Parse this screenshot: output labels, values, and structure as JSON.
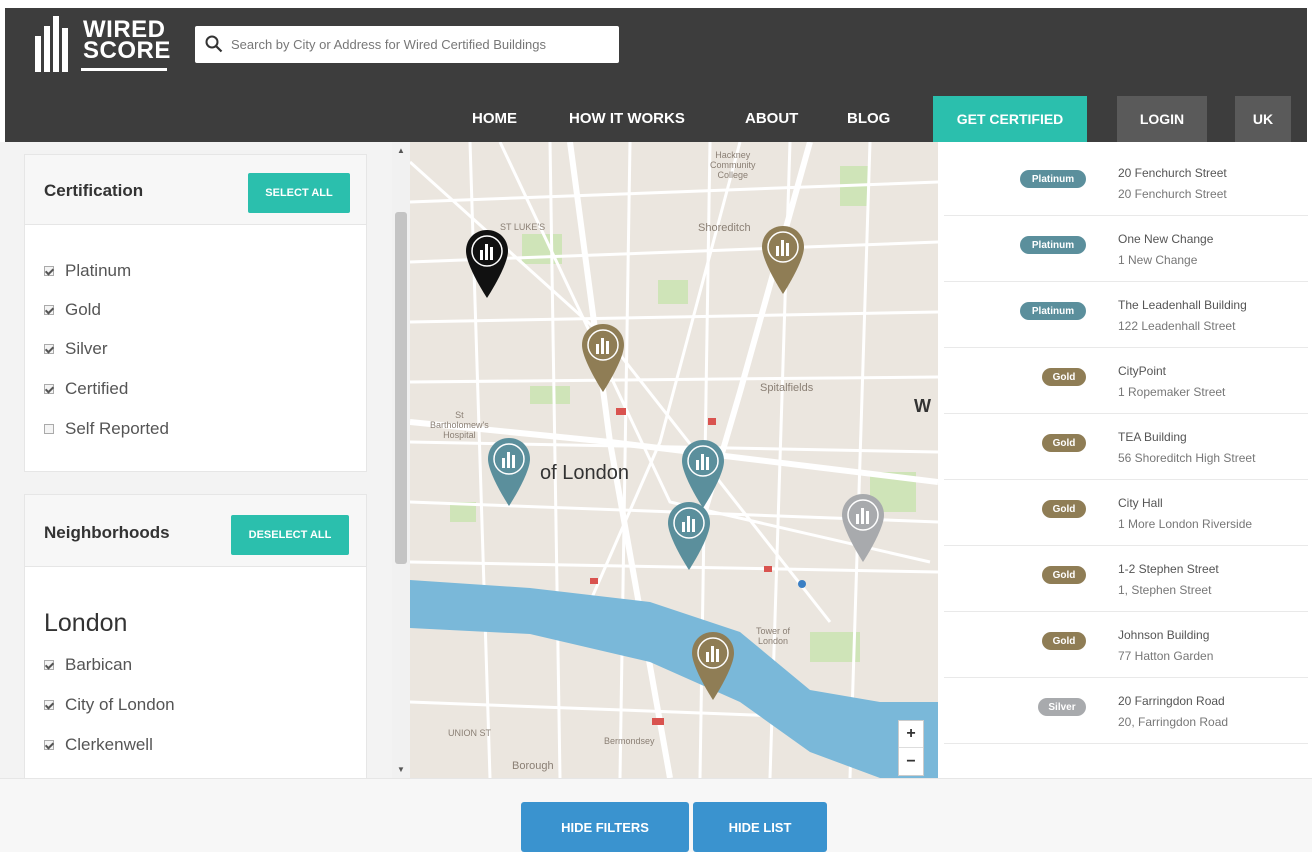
{
  "brand": {
    "line1": "WIRED",
    "line2": "SCORE"
  },
  "search": {
    "placeholder": "Search by City or Address for Wired Certified Buildings"
  },
  "nav": {
    "links": [
      "HOME",
      "HOW IT WORKS",
      "ABOUT",
      "BLOG"
    ],
    "get_certified": "GET CERTIFIED",
    "login": "LOGIN",
    "region": "UK"
  },
  "filters": {
    "certification": {
      "title": "Certification",
      "button": "SELECT ALL",
      "options": [
        {
          "label": "Platinum",
          "checked": true
        },
        {
          "label": "Gold",
          "checked": true
        },
        {
          "label": "Silver",
          "checked": true
        },
        {
          "label": "Certified",
          "checked": true
        },
        {
          "label": "Self Reported",
          "checked": false
        }
      ]
    },
    "neighborhoods": {
      "title": "Neighborhoods",
      "button": "DESELECT ALL",
      "city": "London",
      "options": [
        {
          "label": "Barbican",
          "checked": true
        },
        {
          "label": "City of London",
          "checked": true
        },
        {
          "label": "Clerkenwell",
          "checked": true
        }
      ]
    }
  },
  "map": {
    "labels": {
      "hackney": "Hackney\nCommunity\nCollege",
      "shoreditch": "Shoreditch",
      "st_lukes": "ST LUKE'S",
      "spitalfields": "Spitalfields",
      "barts": "St\nBartholomew's\nHospital",
      "city_of_london": "of London",
      "tower": "Tower of\nLondon",
      "union_st": "UNION ST",
      "southwark": "Bermondsey",
      "borough": "Borough",
      "w": "W"
    },
    "zoom_in": "+",
    "zoom_out": "−",
    "colors": {
      "platinum": "#5b8f9c",
      "gold": "#8f7d55",
      "silver": "#a8aaad",
      "selected": "#111111"
    }
  },
  "buildings": [
    {
      "tier": "Platinum",
      "tier_key": "platinum",
      "name": "20 Fenchurch Street",
      "address": "20 Fenchurch Street"
    },
    {
      "tier": "Platinum",
      "tier_key": "platinum",
      "name": "One New Change",
      "address": "1 New Change"
    },
    {
      "tier": "Platinum",
      "tier_key": "platinum",
      "name": "The Leadenhall Building",
      "address": "122 Leadenhall Street"
    },
    {
      "tier": "Gold",
      "tier_key": "gold",
      "name": "CityPoint",
      "address": "1 Ropemaker Street"
    },
    {
      "tier": "Gold",
      "tier_key": "gold",
      "name": "TEA Building",
      "address": "56 Shoreditch High Street"
    },
    {
      "tier": "Gold",
      "tier_key": "gold",
      "name": "City Hall",
      "address": "1 More London Riverside"
    },
    {
      "tier": "Gold",
      "tier_key": "gold",
      "name": "1-2 Stephen Street",
      "address": "1, Stephen Street"
    },
    {
      "tier": "Gold",
      "tier_key": "gold",
      "name": "Johnson Building",
      "address": "77 Hatton Garden"
    },
    {
      "tier": "Silver",
      "tier_key": "silver",
      "name": "20 Farringdon Road",
      "address": "20, Farringdon Road"
    }
  ],
  "footer": {
    "hide_filters": "HIDE FILTERS",
    "hide_list": "HIDE LIST"
  },
  "tier_colors": {
    "platinum": "#5b8f9c",
    "gold": "#8f7d55",
    "silver": "#a8aaad"
  }
}
